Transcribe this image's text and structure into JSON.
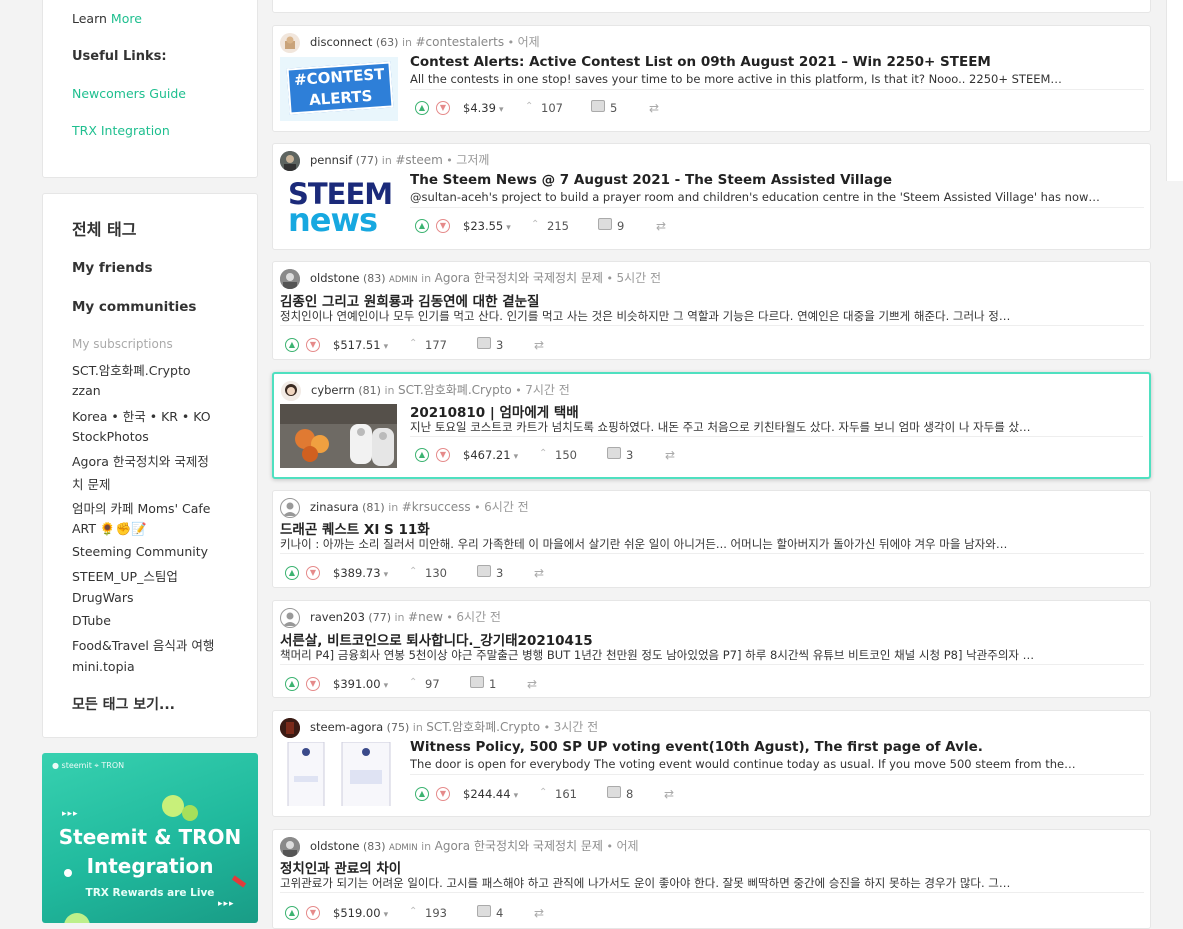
{
  "left_top": {
    "learn_prefix": "Learn",
    "learn_more": "More",
    "useful_links": "Useful Links:",
    "newcomers_guide": "Newcomers Guide",
    "trx_integration": "TRX Integration"
  },
  "tags_panel": {
    "title": "전체 태그",
    "my_friends": "My friends",
    "my_communities": "My communities",
    "subscriptions_header": "My subscriptions",
    "subscriptions": [
      "SCT.암호화폐.Crypto",
      "zzan",
      "Korea • 한국 • KR • KO",
      "StockPhotos",
      "Agora 한국정치와 국제정",
      "치 문제",
      "엄마의 카페 Moms' Cafe",
      "ART 🌻✊📝",
      "Steeming Community",
      "STEEM_UP_스팀업",
      "DrugWars",
      "DTube",
      "Food&Travel 음식과 여행",
      "mini.topia"
    ],
    "all_tags": "모든 태그 보기..."
  },
  "banner": {
    "logos": "● steemit  ⌖ TRON",
    "title_line1": "Steemit & TRON",
    "title_line2": "Integration",
    "subtitle": "TRX Rewards are Live",
    "arrows": "▸▸▸"
  },
  "posts": [
    {
      "author": "disconnect",
      "rep": "(63)",
      "admin": "",
      "in": "in",
      "community": "#contestalerts",
      "dot": "•",
      "time": "어제",
      "title": "Contest Alerts: Active Contest List on 09th August 2021 – Win 2250+ STEEM",
      "desc": "All the contests in one stop! saves your time to be more active in this platform, Is that it? Nooo.. 2250+ STEEM…",
      "payout": "$4.39",
      "votes": "107",
      "comments": "5",
      "thumb_text": "#CONTEST ALERTS"
    },
    {
      "author": "pennsif",
      "rep": "(77)",
      "admin": "",
      "in": "in",
      "community": "#steem",
      "dot": "•",
      "time": "그저께",
      "title": "The Steem News @ 7 August 2021 - The Steem Assisted Village",
      "desc": "@sultan-aceh's project to build a prayer room and children's education centre in the 'Steem Assisted Village' has now…",
      "payout": "$23.55",
      "votes": "215",
      "comments": "9",
      "thumb_text1": "STEEM",
      "thumb_text2": "news"
    },
    {
      "author": "oldstone",
      "rep": "(83)",
      "admin": "ADMIN",
      "in": "in",
      "community": "Agora 한국정치와 국제정치 문제",
      "dot": "•",
      "time": "5시간 전",
      "title": "김종인 그리고 원희룡과 김동연에 대한 곁눈질",
      "desc": "정치인이나 연예인이나 모두 인기를 먹고 산다. 인기를 먹고 사는 것은 비슷하지만 그 역할과 기능은 다르다. 연예인은 대중을 기쁘게 해준다. 그러나 정…",
      "payout": "$517.51",
      "votes": "177",
      "comments": "3"
    },
    {
      "author": "cyberrn",
      "rep": "(81)",
      "admin": "",
      "in": "in",
      "community": "SCT.암호화폐.Crypto",
      "dot": "•",
      "time": "7시간 전",
      "title": "20210810 | 엄마에게 택배",
      "desc": "지난 토요일 코스트코 카트가 넘치도록 쇼핑하였다. 내돈 주고 처음으로 키친타월도 샀다. 자두를 보니 엄마 생각이 나 자두를 샀…",
      "payout": "$467.21",
      "votes": "150",
      "comments": "3"
    },
    {
      "author": "zinasura",
      "rep": "(81)",
      "admin": "",
      "in": "in",
      "community": "#krsuccess",
      "dot": "•",
      "time": "6시간 전",
      "title": "드래곤 퀘스트 XI S 11화",
      "desc": "키나이 : 아까는 소리 질러서 미안해. 우리 가족한테 이 마을에서 살기란 쉬운 일이 아니거든... 어머니는 할아버지가 돌아가신 뒤에야 겨우 마을 남자와…",
      "payout": "$389.73",
      "votes": "130",
      "comments": "3"
    },
    {
      "author": "raven203",
      "rep": "(77)",
      "admin": "",
      "in": "in",
      "community": "#new",
      "dot": "•",
      "time": "6시간 전",
      "title": "서른살, 비트코인으로 퇴사합니다._강기태20210415",
      "desc": "책머리 P4] 금융회사 연봉 5천이상 야근 주말출근 병행 BUT 1년간 천만원 정도 남아있었음 P7] 하루 8시간씩 유튜브 비트코인 채널 시청 P8] 낙관주의자 …",
      "payout": "$391.00",
      "votes": "97",
      "comments": "1"
    },
    {
      "author": "steem-agora",
      "rep": "(75)",
      "admin": "",
      "in": "in",
      "community": "SCT.암호화폐.Crypto",
      "dot": "•",
      "time": "3시간 전",
      "title": "Witness Policy, 500 SP UP voting event(10th Agust), The first page of Avle.",
      "desc": "The door is open for everybody The voting event would continue today as usual. If you move 500 steem from the…",
      "payout": "$244.44",
      "votes": "161",
      "comments": "8"
    },
    {
      "author": "oldstone",
      "rep": "(83)",
      "admin": "ADMIN",
      "in": "in",
      "community": "Agora 한국정치와 국제정치 문제",
      "dot": "•",
      "time": "어제",
      "title": "정치인과 관료의 차이",
      "desc": "고위관료가 되기는 어려운 일이다. 고시를 패스해야 하고 관직에 나가서도 운이 좋아야 한다. 잘못 삐딱하면 중간에 승진을 하지 못하는 경우가 많다. 그…",
      "payout": "$519.00",
      "votes": "193",
      "comments": "4"
    }
  ],
  "icons": {
    "upvote": "▲",
    "downvote": "▼",
    "votes": "⌃",
    "caret": "▾",
    "resteem": "⇄"
  }
}
